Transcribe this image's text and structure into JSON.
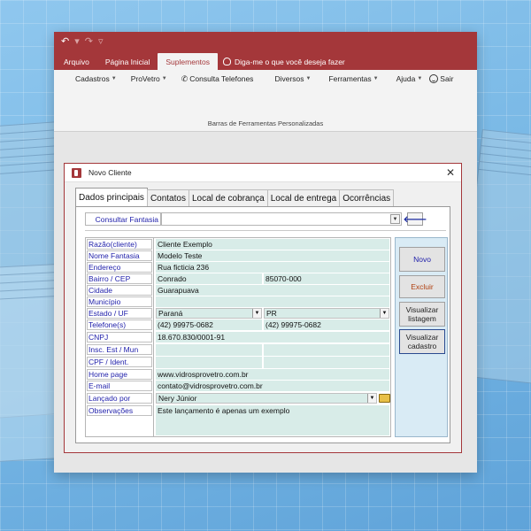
{
  "ribbon": {
    "tabs": [
      "Arquivo",
      "Página Inicial",
      "Suplementos"
    ],
    "active_tab": "Suplementos",
    "tell_me": "Diga-me o que você deseja fazer",
    "menu": {
      "cadastros": "Cadastros",
      "provetro": "ProVetro",
      "consulta": "Consulta Telefones",
      "diversos": "Diversos",
      "ferramentas": "Ferramentas",
      "ajuda": "Ajuda",
      "sair": "Sair"
    },
    "group_label": "Barras de Ferramentas Personalizadas"
  },
  "dialog": {
    "title": "Novo Cliente",
    "close": "✕",
    "tabs": [
      "Dados principais",
      "Contatos",
      "Local de cobrança",
      "Local de entrega",
      "Ocorrências"
    ],
    "active_tab": "Dados principais",
    "consult_label": "Consultar Fantasia",
    "labels": {
      "razao": "Razão(cliente)",
      "fantasia": "Nome Fantasia",
      "endereco": "Endereço",
      "bairro": "Bairro / CEP",
      "cidade": "Cidade",
      "municipio": "Município",
      "estado": "Estado / UF",
      "telefones": "Telefone(s)",
      "cnpj": "CNPJ",
      "insc": "Insc. Est / Mun",
      "cpf": "CPF / Ident.",
      "home": "Home page",
      "email": "E-mail",
      "lancado": "Lançado por",
      "obs": "Observações"
    },
    "values": {
      "razao": "Cliente Exemplo",
      "fantasia": "Modelo Teste",
      "endereco": "Rua ficticia 236",
      "bairro": "Conrado",
      "cep": "85070-000",
      "cidade": "Guarapuava",
      "estado": "Paraná",
      "uf": "PR",
      "telefone1": "(42) 99975-0682",
      "telefone2": "(42) 99975-0682",
      "cnpj": "18.670.830/0001-91",
      "home": "www.vidrosprovetro.com.br",
      "email": "contato@vidrosprovetro.com.br",
      "lancado": "Nery Júnior",
      "obs": "Este lançamento é apenas um exemplo"
    },
    "buttons": {
      "novo": "Novo",
      "excluir": "Excluir",
      "listagem": "Visualizar listagem",
      "cadastro": "Visualizar cadastro"
    }
  },
  "colors": {
    "access_red": "#a4373a",
    "field_fill": "#d8ece8",
    "label_blue": "#1e1eaa",
    "panel_blue": "#d9ebf5"
  }
}
